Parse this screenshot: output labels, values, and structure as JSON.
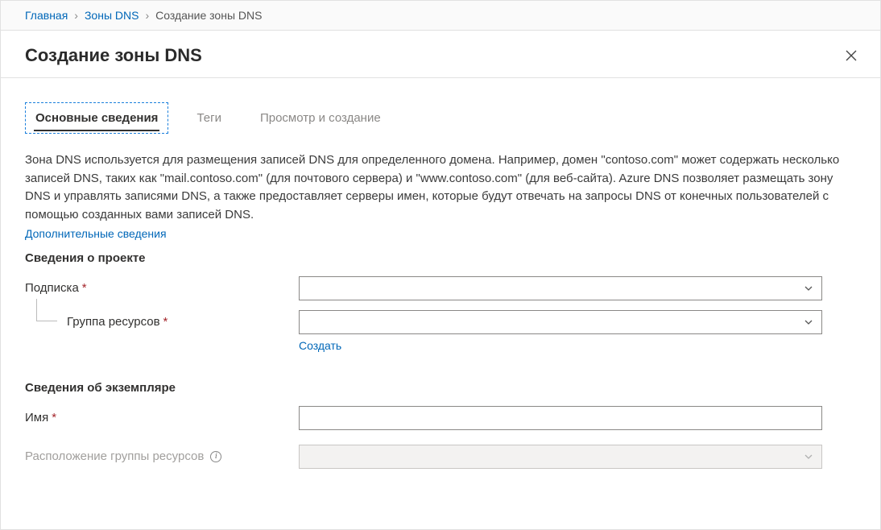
{
  "breadcrumb": {
    "home": "Главная",
    "zones": "Зоны DNS",
    "current": "Создание зоны DNS"
  },
  "page_title": "Создание зоны DNS",
  "tabs": {
    "basics": "Основные сведения",
    "tags": "Теги",
    "review": "Просмотр и создание"
  },
  "description": "Зона DNS используется для размещения записей DNS для определенного домена. Например, домен \"contoso.com\" может содержать несколько записей DNS, таких как \"mail.contoso.com\" (для почтового сервера) и \"www.contoso.com\" (для веб-сайта). Azure DNS позволяет размещать зону DNS и управлять записями DNS, а также предоставляет серверы имен, которые будут отвечать на запросы DNS от конечных пользователей с помощью созданных вами записей DNS.",
  "learn_more": "Дополнительные сведения",
  "project_section": "Сведения о проекте",
  "subscription_label": "Подписка",
  "resource_group_label": "Группа ресурсов",
  "create_new": "Создать",
  "instance_section": "Сведения об экземпляре",
  "name_label": "Имя",
  "rg_location_label": "Расположение группы ресурсов",
  "required_marker": "*"
}
